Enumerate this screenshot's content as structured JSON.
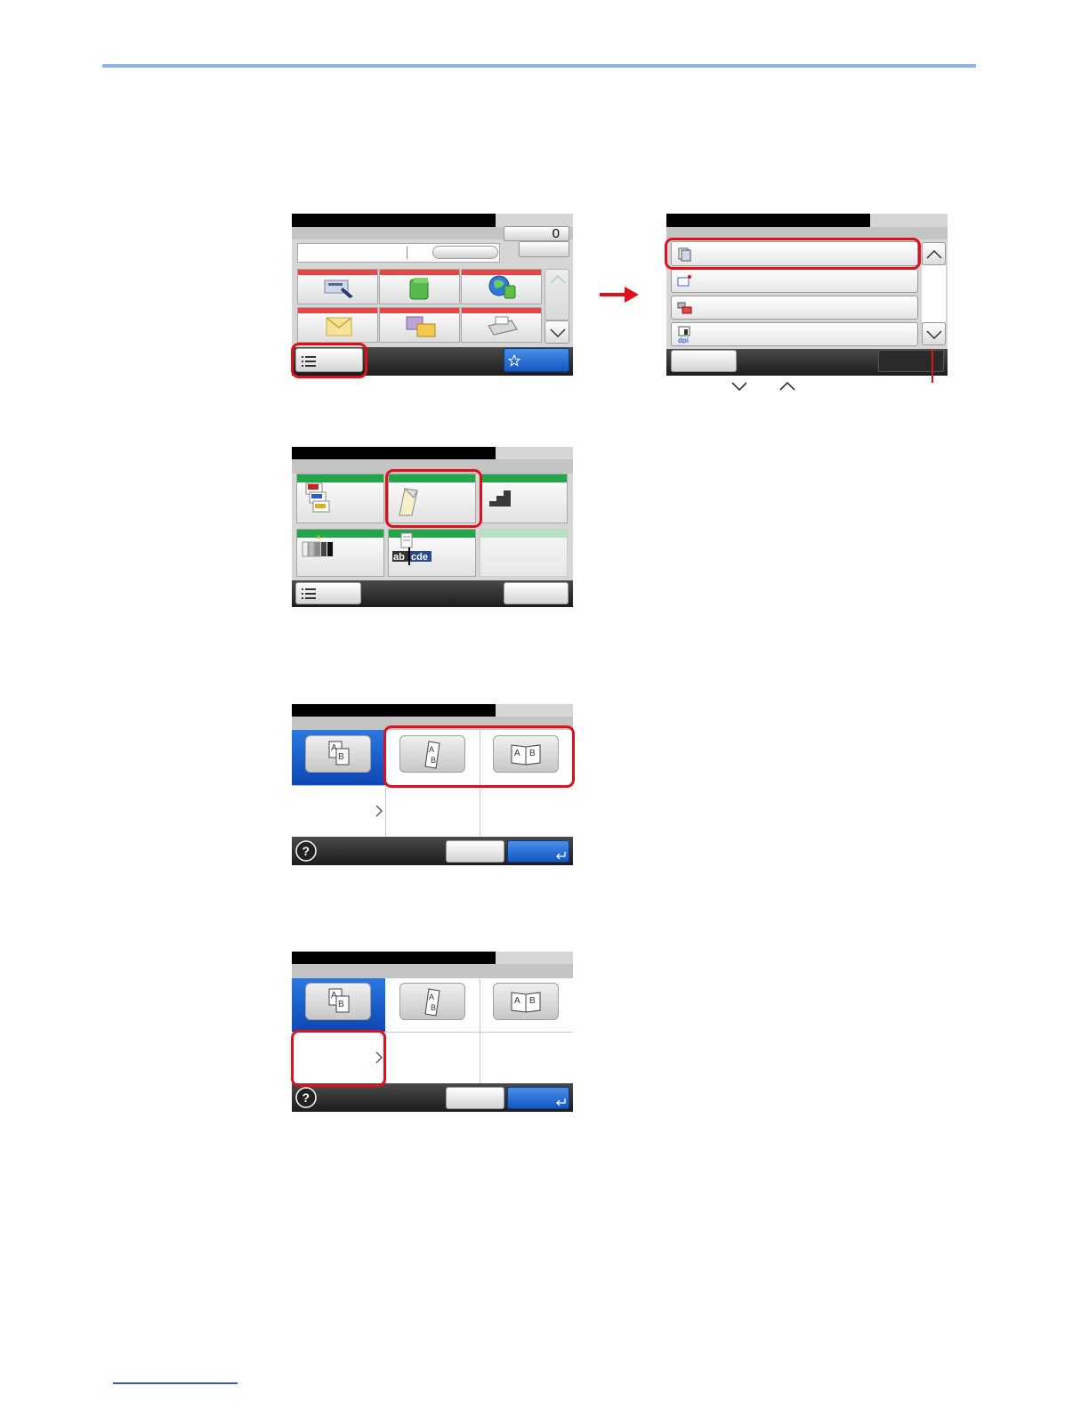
{
  "screens": {
    "home": {
      "job_counter": "0"
    },
    "options": {}
  },
  "annotations": {
    "arrow": "right-arrow-icon"
  },
  "colors": {
    "highlight": "#e0101a",
    "app_stripe": "#e84545",
    "function_stripe": "#21a64a",
    "selected_blue": "#1356c4"
  }
}
